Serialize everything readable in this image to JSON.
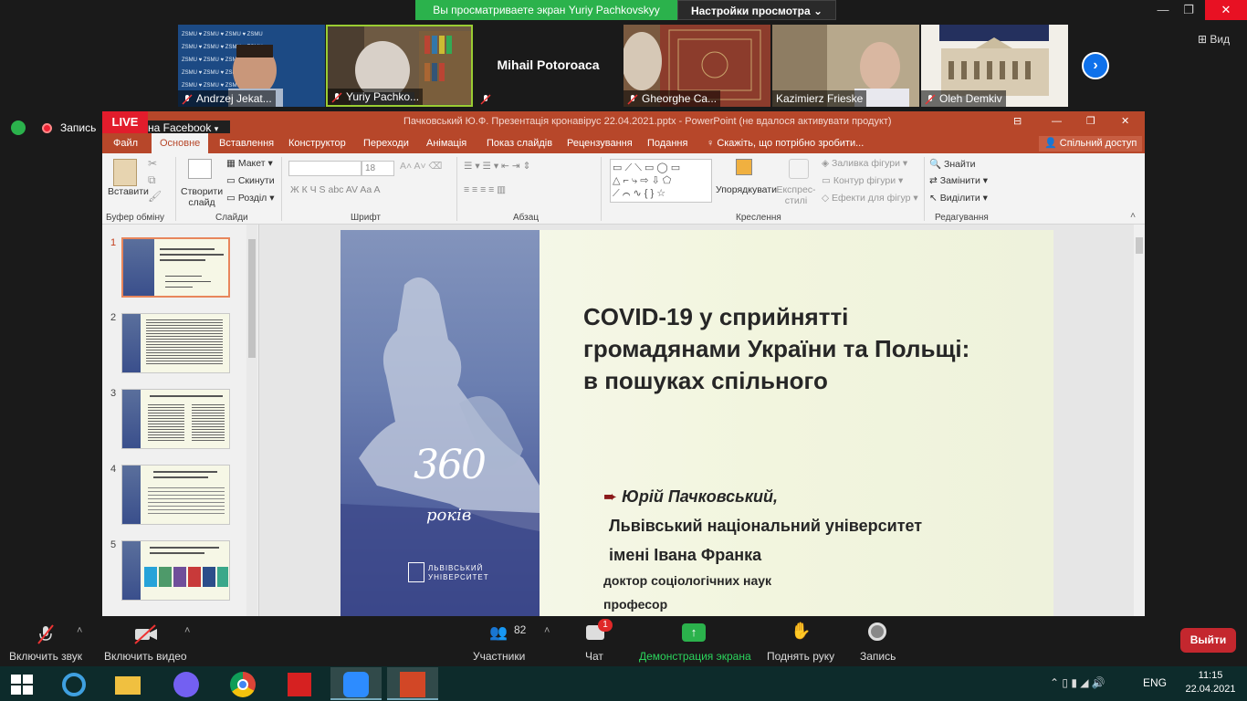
{
  "zoom": {
    "share_banner": "Вы просматриваете экран Yuriy Pachkovskyy",
    "view_settings": "Настройки просмотра",
    "view_label": "Вид",
    "participants_tiles": [
      {
        "name": "Andrzej Jekat..."
      },
      {
        "name": "Yuriy Pachko..."
      },
      {
        "name": "Mihail Potoroaca"
      },
      {
        "name": "Gheorghe Ca..."
      },
      {
        "name": "Kazimierz Frieske"
      },
      {
        "name": "Oleh Demkiv"
      }
    ],
    "recording_label": "Запись",
    "live_label": "LIVE",
    "facebook_label": "на Facebook",
    "bottom": {
      "mute": "Включить звук",
      "video": "Включить видео",
      "participants": "Участники",
      "participants_count": "82",
      "chat": "Чат",
      "chat_badge": "1",
      "share": "Демонстрация экрана",
      "raise_hand": "Поднять руку",
      "record": "Запись",
      "leave": "Выйти"
    }
  },
  "ppt": {
    "window_title": "Пачковський Ю.Ф. Презентація кронавірус  22.04.2021.pptx - PowerPoint (не вдалося активувати продукт)",
    "tabs": [
      "Файл",
      "Основне",
      "Вставлення",
      "Конструктор",
      "Переходи",
      "Анімація",
      "Показ слайдів",
      "Рецензування",
      "Подання"
    ],
    "tell_me": "Скажіть, що потрібно зробити...",
    "share": "Спільний доступ",
    "ribbon": {
      "paste": "Вставити",
      "clipboard": "Буфер обміну",
      "new_slide": "Створити слайд",
      "layout": "Макет",
      "reset": "Скинути",
      "section": "Розділ",
      "slides": "Слайди",
      "font": "Шрифт",
      "font_size": "18",
      "paragraph": "Абзац",
      "arrange": "Упорядкувати",
      "quick_styles": "Експрес-стилі",
      "shape_fill": "Заливка фігури",
      "shape_outline": "Контур фігури",
      "shape_effects": "Ефекти для фігур",
      "drawing": "Креслення",
      "find": "Знайти",
      "replace": "Замінити",
      "select": "Виділити",
      "editing": "Редагування"
    },
    "thumbnail_numbers": [
      "1",
      "2",
      "3",
      "4",
      "5"
    ],
    "slide": {
      "title_line1": "COVID-19 у сприйнятті",
      "title_line2": "громадянами України та Польщі:",
      "title_line3": "в  пошуках спільного",
      "bullet": "Юрій Пачковський,",
      "affil1": "Львівський національний університет",
      "affil2": "імені Івана Франка",
      "degree": "доктор соціологічних наук",
      "position": "професор",
      "left_number": "360",
      "left_years": "років",
      "left_univ": "ЛЬВІВСЬКИЙ УНІВЕРСИТЕТ"
    }
  },
  "taskbar": {
    "lang": "ENG",
    "time": "11:15",
    "date": "22.04.2021"
  }
}
